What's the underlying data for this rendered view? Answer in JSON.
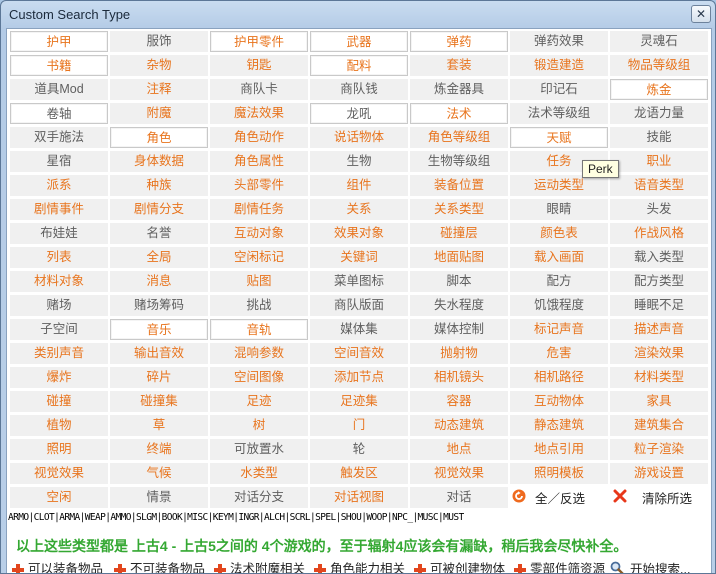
{
  "window": {
    "title": "Custom Search Type",
    "close_symbol": "✕"
  },
  "colors": {
    "orange": "#e8741d",
    "gray": "#5f5f5f",
    "green_notice": "#34a832"
  },
  "grid": {
    "rows": [
      [
        {
          "t": "护甲",
          "c": "o",
          "s": 0
        },
        {
          "t": "服饰",
          "c": "g",
          "s": 1
        },
        {
          "t": "护甲零件",
          "c": "o",
          "s": 0
        },
        {
          "t": "武器",
          "c": "o",
          "s": 0
        },
        {
          "t": "弹药",
          "c": "o",
          "s": 0
        },
        {
          "t": "弹药效果",
          "c": "g",
          "s": 1
        },
        {
          "t": "灵魂石",
          "c": "g",
          "s": 1
        }
      ],
      [
        {
          "t": "书籍",
          "c": "o",
          "s": 0
        },
        {
          "t": "杂物",
          "c": "o",
          "s": 1
        },
        {
          "t": "钥匙",
          "c": "o",
          "s": 1
        },
        {
          "t": "配料",
          "c": "o",
          "s": 0
        },
        {
          "t": "套装",
          "c": "o",
          "s": 1
        },
        {
          "t": "锻造建造",
          "c": "o",
          "s": 1
        },
        {
          "t": "物品等级组",
          "c": "o",
          "s": 1
        }
      ],
      [
        {
          "t": "道具Mod",
          "c": "g",
          "s": 1
        },
        {
          "t": "注释",
          "c": "o",
          "s": 1
        },
        {
          "t": "商队卡",
          "c": "g",
          "s": 1
        },
        {
          "t": "商队钱",
          "c": "g",
          "s": 1
        },
        {
          "t": "炼金器具",
          "c": "g",
          "s": 1
        },
        {
          "t": "印记石",
          "c": "g",
          "s": 1
        },
        {
          "t": "炼金",
          "c": "o",
          "s": 0
        }
      ],
      [
        {
          "t": "卷轴",
          "c": "g",
          "s": 0
        },
        {
          "t": "附魔",
          "c": "o",
          "s": 1
        },
        {
          "t": "魔法效果",
          "c": "o",
          "s": 1
        },
        {
          "t": "龙吼",
          "c": "g",
          "s": 0
        },
        {
          "t": "法术",
          "c": "o",
          "s": 0
        },
        {
          "t": "法术等级组",
          "c": "g",
          "s": 1
        },
        {
          "t": "龙语力量",
          "c": "g",
          "s": 1
        }
      ],
      [
        {
          "t": "双手施法",
          "c": "g",
          "s": 1
        },
        {
          "t": "角色",
          "c": "o",
          "s": 0
        },
        {
          "t": "角色动作",
          "c": "o",
          "s": 1
        },
        {
          "t": "说话物体",
          "c": "o",
          "s": 1
        },
        {
          "t": "角色等级组",
          "c": "o",
          "s": 1
        },
        {
          "t": "天赋",
          "c": "o",
          "s": 0
        },
        {
          "t": "技能",
          "c": "g",
          "s": 1
        }
      ],
      [
        {
          "t": "星宿",
          "c": "g",
          "s": 1
        },
        {
          "t": "身体数据",
          "c": "o",
          "s": 1
        },
        {
          "t": "角色属性",
          "c": "o",
          "s": 1
        },
        {
          "t": "生物",
          "c": "g",
          "s": 1
        },
        {
          "t": "生物等级组",
          "c": "g",
          "s": 1
        },
        {
          "t": "任务",
          "c": "o",
          "s": 1
        },
        {
          "t": "职业",
          "c": "o",
          "s": 1
        }
      ],
      [
        {
          "t": "派系",
          "c": "o",
          "s": 1
        },
        {
          "t": "种族",
          "c": "o",
          "s": 1
        },
        {
          "t": "头部零件",
          "c": "o",
          "s": 1
        },
        {
          "t": "组件",
          "c": "o",
          "s": 1
        },
        {
          "t": "装备位置",
          "c": "o",
          "s": 1
        },
        {
          "t": "运动类型",
          "c": "o",
          "s": 1
        },
        {
          "t": "语音类型",
          "c": "o",
          "s": 1
        }
      ],
      [
        {
          "t": "剧情事件",
          "c": "o",
          "s": 1
        },
        {
          "t": "剧情分支",
          "c": "o",
          "s": 1
        },
        {
          "t": "剧情任务",
          "c": "o",
          "s": 1
        },
        {
          "t": "关系",
          "c": "o",
          "s": 1
        },
        {
          "t": "关系类型",
          "c": "o",
          "s": 1
        },
        {
          "t": "眼睛",
          "c": "g",
          "s": 1
        },
        {
          "t": "头发",
          "c": "g",
          "s": 1
        }
      ],
      [
        {
          "t": "布娃娃",
          "c": "g",
          "s": 1
        },
        {
          "t": "名誉",
          "c": "g",
          "s": 1
        },
        {
          "t": "互动对象",
          "c": "o",
          "s": 1
        },
        {
          "t": "效果对象",
          "c": "o",
          "s": 1
        },
        {
          "t": "碰撞层",
          "c": "o",
          "s": 1
        },
        {
          "t": "颜色表",
          "c": "o",
          "s": 1
        },
        {
          "t": "作战风格",
          "c": "o",
          "s": 1
        }
      ],
      [
        {
          "t": "列表",
          "c": "o",
          "s": 1
        },
        {
          "t": "全局",
          "c": "o",
          "s": 1
        },
        {
          "t": "空闲标记",
          "c": "o",
          "s": 1
        },
        {
          "t": "关键词",
          "c": "o",
          "s": 1
        },
        {
          "t": "地面贴图",
          "c": "o",
          "s": 1
        },
        {
          "t": "载入画面",
          "c": "o",
          "s": 1
        },
        {
          "t": "载入类型",
          "c": "g",
          "s": 1
        }
      ],
      [
        {
          "t": "材料对象",
          "c": "o",
          "s": 1
        },
        {
          "t": "消息",
          "c": "o",
          "s": 1
        },
        {
          "t": "贴图",
          "c": "o",
          "s": 1
        },
        {
          "t": "菜单图标",
          "c": "g",
          "s": 1
        },
        {
          "t": "脚本",
          "c": "g",
          "s": 1
        },
        {
          "t": "配方",
          "c": "g",
          "s": 1
        },
        {
          "t": "配方类型",
          "c": "g",
          "s": 1
        }
      ],
      [
        {
          "t": "赌场",
          "c": "g",
          "s": 1
        },
        {
          "t": "赌场筹码",
          "c": "g",
          "s": 1
        },
        {
          "t": "挑战",
          "c": "g",
          "s": 1
        },
        {
          "t": "商队版面",
          "c": "g",
          "s": 1
        },
        {
          "t": "失水程度",
          "c": "g",
          "s": 1
        },
        {
          "t": "饥饿程度",
          "c": "g",
          "s": 1
        },
        {
          "t": "睡眠不足",
          "c": "g",
          "s": 1
        }
      ],
      [
        {
          "t": "子空间",
          "c": "g",
          "s": 1
        },
        {
          "t": "音乐",
          "c": "o",
          "s": 0
        },
        {
          "t": "音轨",
          "c": "o",
          "s": 0
        },
        {
          "t": "媒体集",
          "c": "g",
          "s": 1
        },
        {
          "t": "媒体控制",
          "c": "g",
          "s": 1
        },
        {
          "t": "标记声音",
          "c": "o",
          "s": 1
        },
        {
          "t": "描述声音",
          "c": "o",
          "s": 1
        }
      ],
      [
        {
          "t": "类别声音",
          "c": "o",
          "s": 1
        },
        {
          "t": "输出音效",
          "c": "o",
          "s": 1
        },
        {
          "t": "混响参数",
          "c": "o",
          "s": 1
        },
        {
          "t": "空间音效",
          "c": "o",
          "s": 1
        },
        {
          "t": "抛射物",
          "c": "o",
          "s": 1
        },
        {
          "t": "危害",
          "c": "o",
          "s": 1
        },
        {
          "t": "渲染效果",
          "c": "o",
          "s": 1
        }
      ],
      [
        {
          "t": "爆炸",
          "c": "o",
          "s": 1
        },
        {
          "t": "碎片",
          "c": "o",
          "s": 1
        },
        {
          "t": "空间图像",
          "c": "o",
          "s": 1
        },
        {
          "t": "添加节点",
          "c": "o",
          "s": 1
        },
        {
          "t": "相机镜头",
          "c": "o",
          "s": 1
        },
        {
          "t": "相机路径",
          "c": "o",
          "s": 1
        },
        {
          "t": "材料类型",
          "c": "o",
          "s": 1
        }
      ],
      [
        {
          "t": "碰撞",
          "c": "o",
          "s": 1
        },
        {
          "t": "碰撞集",
          "c": "o",
          "s": 1
        },
        {
          "t": "足迹",
          "c": "o",
          "s": 1
        },
        {
          "t": "足迹集",
          "c": "o",
          "s": 1
        },
        {
          "t": "容器",
          "c": "o",
          "s": 1
        },
        {
          "t": "互动物体",
          "c": "o",
          "s": 1
        },
        {
          "t": "家具",
          "c": "o",
          "s": 1
        }
      ],
      [
        {
          "t": "植物",
          "c": "o",
          "s": 1
        },
        {
          "t": "草",
          "c": "o",
          "s": 1
        },
        {
          "t": "树",
          "c": "o",
          "s": 1
        },
        {
          "t": "门",
          "c": "o",
          "s": 1
        },
        {
          "t": "动态建筑",
          "c": "o",
          "s": 1
        },
        {
          "t": "静态建筑",
          "c": "o",
          "s": 1
        },
        {
          "t": "建筑集合",
          "c": "o",
          "s": 1
        }
      ],
      [
        {
          "t": "照明",
          "c": "o",
          "s": 1
        },
        {
          "t": "终端",
          "c": "o",
          "s": 1
        },
        {
          "t": "可放置水",
          "c": "g",
          "s": 1
        },
        {
          "t": "轮",
          "c": "g",
          "s": 1
        },
        {
          "t": "地点",
          "c": "o",
          "s": 1
        },
        {
          "t": "地点引用",
          "c": "o",
          "s": 1
        },
        {
          "t": "粒子渲染",
          "c": "o",
          "s": 1
        }
      ],
      [
        {
          "t": "视觉效果",
          "c": "o",
          "s": 1
        },
        {
          "t": "气候",
          "c": "o",
          "s": 1
        },
        {
          "t": "水类型",
          "c": "o",
          "s": 1
        },
        {
          "t": "触发区",
          "c": "o",
          "s": 1
        },
        {
          "t": "视觉效果",
          "c": "o",
          "s": 1
        },
        {
          "t": "照明模板",
          "c": "o",
          "s": 1
        },
        {
          "t": "游戏设置",
          "c": "o",
          "s": 1
        }
      ],
      [
        {
          "t": "空闲",
          "c": "o",
          "s": 1
        },
        {
          "t": "情景",
          "c": "g",
          "s": 1
        },
        {
          "t": "对话分支",
          "c": "g",
          "s": 1
        },
        {
          "t": "对话视图",
          "c": "o",
          "s": 1
        },
        {
          "t": "对话",
          "c": "g",
          "s": 1
        }
      ]
    ]
  },
  "actions": {
    "toggle_label": "全／反选",
    "clear_label": "清除所选"
  },
  "tooltip": {
    "text": "Perk"
  },
  "codes_line": "ARMO|CLOT|ARMA|WEAP|AMMO|SLGM|BOOK|MISC|KEYM|INGR|ALCH|SCRL|SPEL|SHOU|WOOP|NPC_|MUSC|MUST",
  "notice": "以上这些类型都是 上古4 - 上古5之间的 4个游戏的，至于辐射4应该会有漏缺，稍后我会尽快补全。",
  "bottom_buttons": [
    "可以装备物品",
    "不可装备物品",
    "法术附魔相关",
    "角色能力相关",
    "可被创建物体",
    "零部件筛资源",
    "开始搜索..."
  ]
}
